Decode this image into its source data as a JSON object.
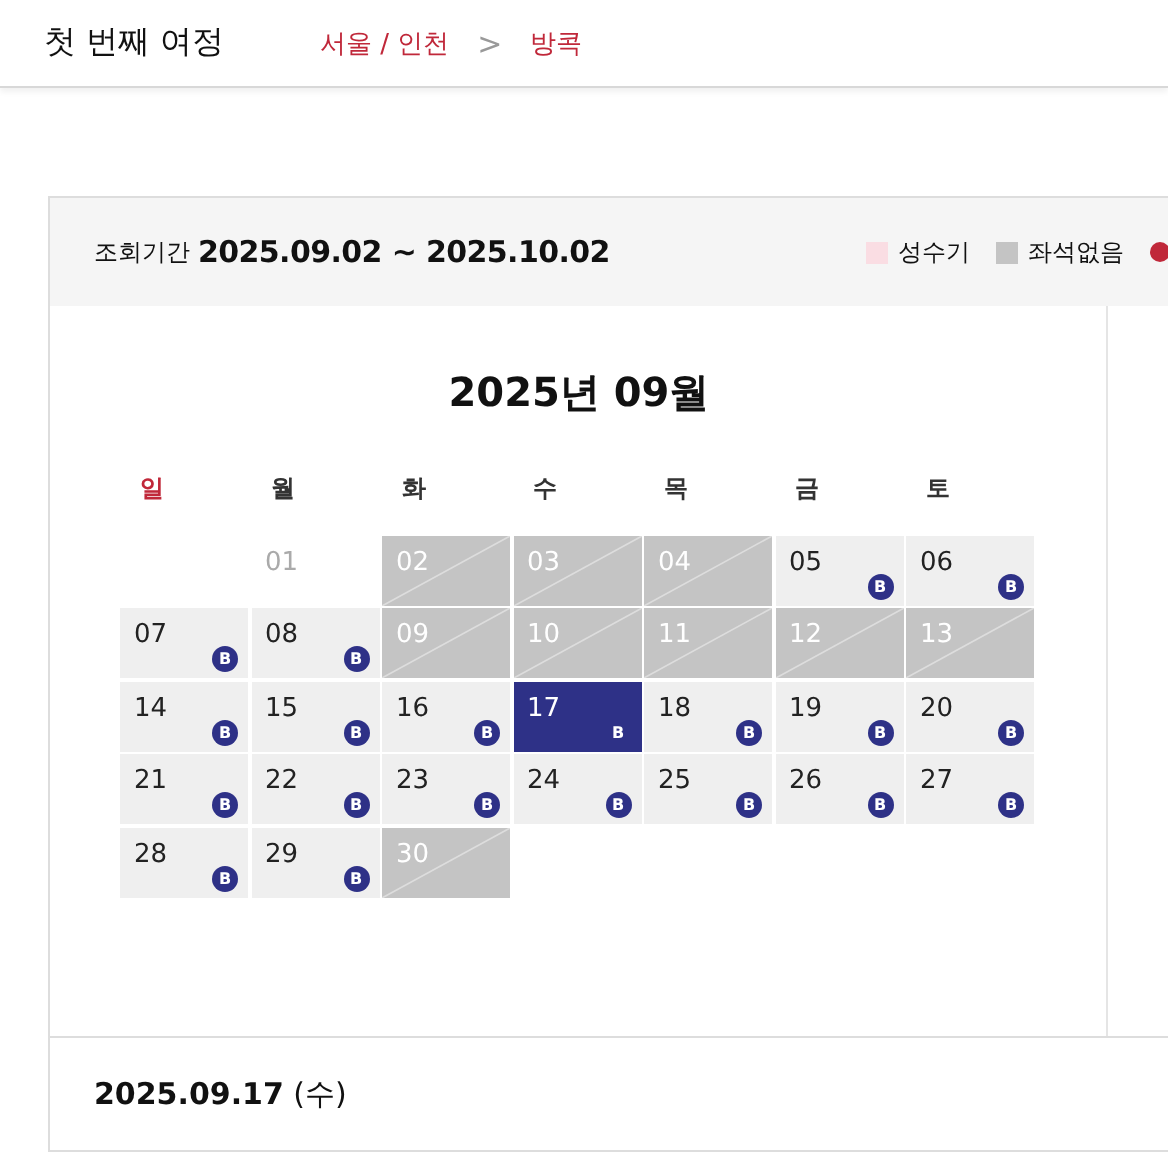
{
  "header": {
    "title": "첫 번째 여정",
    "origin": "서울 / 인천",
    "separator": ">",
    "destination": "방콕"
  },
  "period": {
    "label": "조회기간",
    "range": "2025.09.02 ~ 2025.10.02"
  },
  "legend": [
    {
      "label": "성수기",
      "color": "#fadde3"
    },
    {
      "label": "좌석없음",
      "color": "#c4c4c4"
    }
  ],
  "calendar": {
    "title": "2025년 09월",
    "weekdays": [
      {
        "label": "일",
        "holiday": true
      },
      {
        "label": "월",
        "holiday": false
      },
      {
        "label": "화",
        "holiday": false
      },
      {
        "label": "수",
        "holiday": false
      },
      {
        "label": "목",
        "holiday": false
      },
      {
        "label": "금",
        "holiday": false
      },
      {
        "label": "토",
        "holiday": false
      }
    ],
    "weeks": [
      [
        {
          "kind": "blank"
        },
        {
          "day": "01",
          "kind": "past",
          "selected": false
        },
        {
          "day": "02",
          "kind": "soldout",
          "selected": false
        },
        {
          "day": "03",
          "kind": "soldout",
          "selected": false
        },
        {
          "day": "04",
          "kind": "soldout",
          "selected": false
        },
        {
          "day": "05",
          "kind": "open",
          "badge": "B",
          "selected": false
        },
        {
          "day": "06",
          "kind": "open",
          "badge": "B",
          "selected": false
        }
      ],
      [
        {
          "day": "07",
          "kind": "open",
          "badge": "B",
          "selected": false
        },
        {
          "day": "08",
          "kind": "open",
          "badge": "B",
          "selected": false
        },
        {
          "day": "09",
          "kind": "soldout",
          "selected": false
        },
        {
          "day": "10",
          "kind": "soldout",
          "selected": false
        },
        {
          "day": "11",
          "kind": "soldout",
          "selected": false
        },
        {
          "day": "12",
          "kind": "soldout",
          "selected": false
        },
        {
          "day": "13",
          "kind": "soldout",
          "selected": false
        }
      ],
      [
        {
          "day": "14",
          "kind": "open",
          "badge": "B",
          "selected": false
        },
        {
          "day": "15",
          "kind": "open",
          "badge": "B",
          "selected": false
        },
        {
          "day": "16",
          "kind": "open",
          "badge": "B",
          "selected": false
        },
        {
          "day": "17",
          "kind": "open",
          "badge": "B",
          "selected": true
        },
        {
          "day": "18",
          "kind": "open",
          "badge": "B",
          "selected": false
        },
        {
          "day": "19",
          "kind": "open",
          "badge": "B",
          "selected": false
        },
        {
          "day": "20",
          "kind": "open",
          "badge": "B",
          "selected": false
        }
      ],
      [
        {
          "day": "21",
          "kind": "open",
          "badge": "B",
          "selected": false
        },
        {
          "day": "22",
          "kind": "open",
          "badge": "B",
          "selected": false
        },
        {
          "day": "23",
          "kind": "open",
          "badge": "B",
          "selected": false
        },
        {
          "day": "24",
          "kind": "open",
          "badge": "B",
          "selected": false
        },
        {
          "day": "25",
          "kind": "open",
          "badge": "B",
          "selected": false
        },
        {
          "day": "26",
          "kind": "open",
          "badge": "B",
          "selected": false
        },
        {
          "day": "27",
          "kind": "open",
          "badge": "B",
          "selected": false
        }
      ],
      [
        {
          "day": "28",
          "kind": "open",
          "badge": "B",
          "selected": false
        },
        {
          "day": "29",
          "kind": "open",
          "badge": "B",
          "selected": false
        },
        {
          "day": "30",
          "kind": "soldout",
          "selected": false
        }
      ]
    ]
  },
  "selected_date": "**2025.09.17** (수)"
}
